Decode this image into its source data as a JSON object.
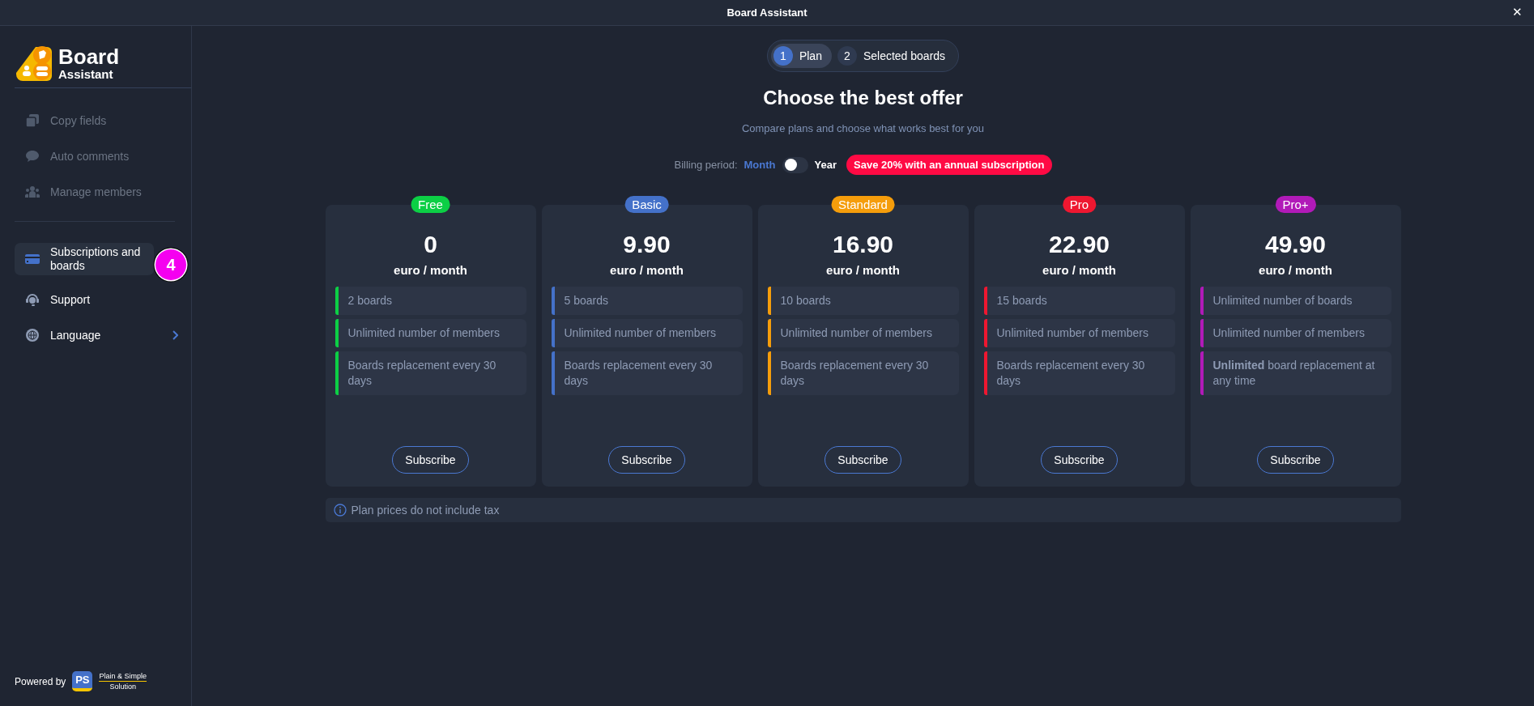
{
  "window": {
    "title": "Board Assistant",
    "close": "✕"
  },
  "sidebar": {
    "logo": {
      "line1": "Board",
      "line2": "Assistant"
    },
    "items": [
      {
        "label": "Copy fields",
        "disabled": true,
        "selected": false
      },
      {
        "label": "Auto comments",
        "disabled": true,
        "selected": false
      },
      {
        "label": "Manage members",
        "disabled": true,
        "selected": false
      }
    ],
    "items2": [
      {
        "label": "Subscriptions and boards",
        "disabled": false,
        "selected": true,
        "marker": "4"
      },
      {
        "label": "Support",
        "disabled": false,
        "selected": false
      },
      {
        "label": "Language",
        "disabled": false,
        "selected": false,
        "submenu": true
      }
    ],
    "footer": {
      "powered": "Powered by",
      "mark": "PS",
      "name1": "Plain & Simple",
      "name2": "Solution"
    }
  },
  "steps": [
    {
      "number": "1",
      "label": "Plan",
      "selected": true
    },
    {
      "number": "2",
      "label": "Selected boards",
      "selected": false
    }
  ],
  "heading": "Choose the best offer",
  "subtitle": "Compare plans and choose what works best for you",
  "billing": {
    "label": "Billing period:",
    "options": [
      {
        "label": "Month",
        "selected": true
      },
      {
        "label": "Year",
        "selected": false
      }
    ],
    "annual": false,
    "promo": "Save 20% with an annual subscription"
  },
  "plans": [
    {
      "name": "Free",
      "color": "#0ccf45",
      "price": "0",
      "unit": "euro / month",
      "features": [
        "2 boards",
        "Unlimited number of members",
        "Boards replacement every 30 days"
      ],
      "button": "Subscribe"
    },
    {
      "name": "Basic",
      "color": "#4471c9",
      "price": "9.90",
      "unit": "euro / month",
      "features": [
        "5 boards",
        "Unlimited number of members",
        "Boards replacement every 30 days"
      ],
      "button": "Subscribe"
    },
    {
      "name": "Standard",
      "color": "#f59d0b",
      "price": "16.90",
      "unit": "euro / month",
      "features": [
        "10 boards",
        "Unlimited number of members",
        "Boards replacement every 30 days"
      ],
      "button": "Subscribe"
    },
    {
      "name": "Pro",
      "color": "#ee1730",
      "price": "22.90",
      "unit": "euro / month",
      "features": [
        "15 boards",
        "Unlimited number of members",
        "Boards replacement every 30 days"
      ],
      "button": "Subscribe"
    },
    {
      "name": "Pro+",
      "color": "#b11ab8",
      "price": "49.90",
      "unit": "euro / month",
      "features": [
        "Unlimited number of boards",
        "Unlimited number of members",
        "**Unlimited** board replacement at any time"
      ],
      "button": "Subscribe"
    }
  ],
  "note": "Plan prices do not include tax"
}
